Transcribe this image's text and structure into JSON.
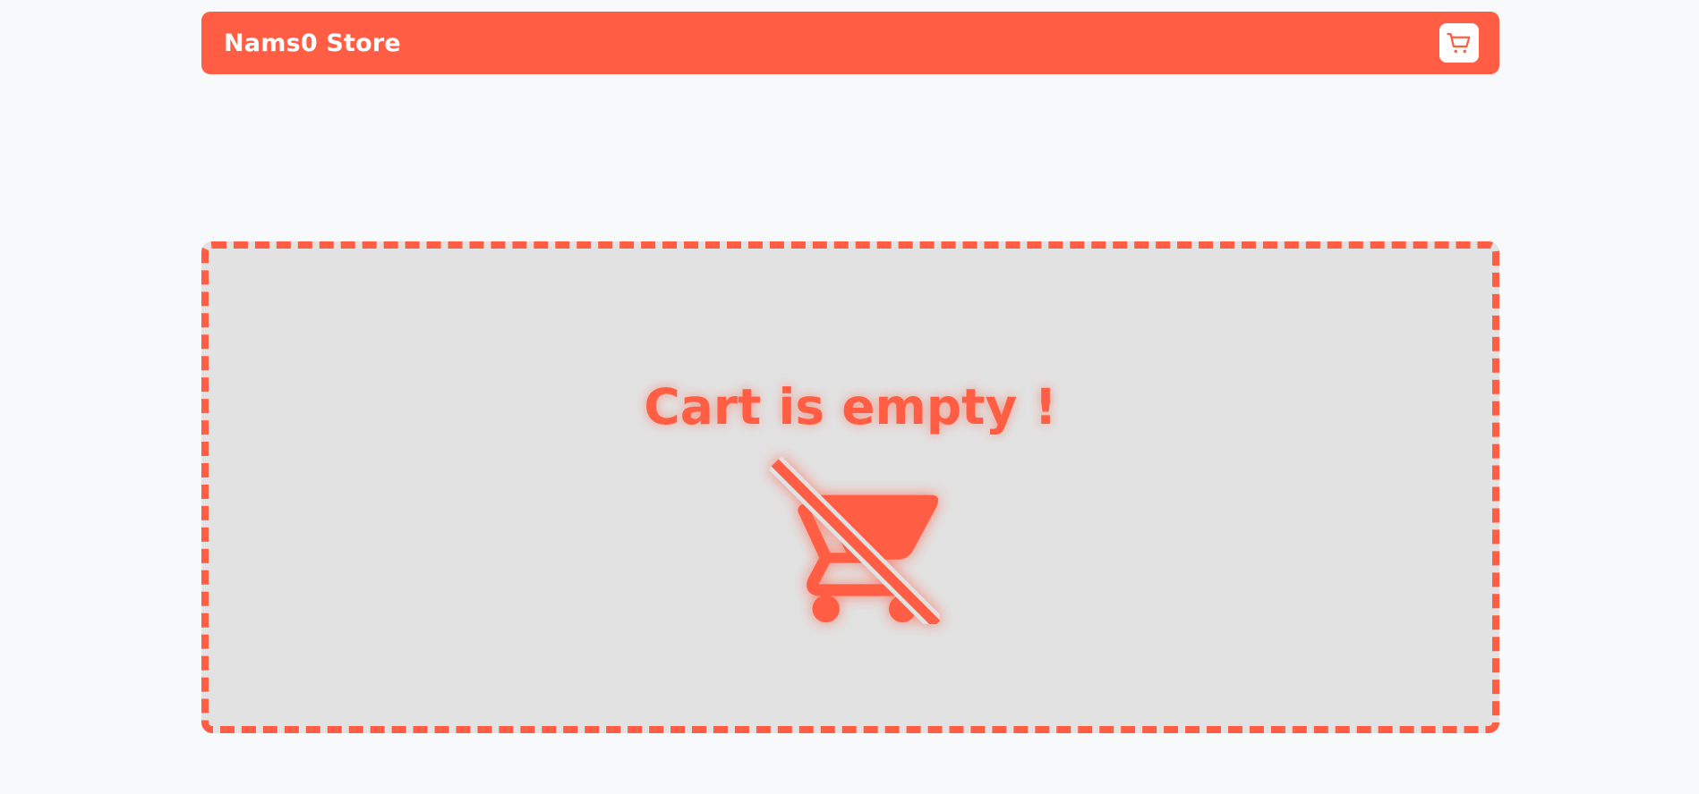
{
  "navbar": {
    "brand": "Nams0 Store",
    "cart_icon": "cart-icon"
  },
  "cart": {
    "empty_message": "Cart is empty !",
    "empty_icon": "remove-shopping-cart-icon"
  },
  "colors": {
    "accent": "#ff5e44",
    "page_background": "#f8f9fa",
    "panel_background": "#e2e2e2",
    "navbar_text": "#ffffff"
  }
}
